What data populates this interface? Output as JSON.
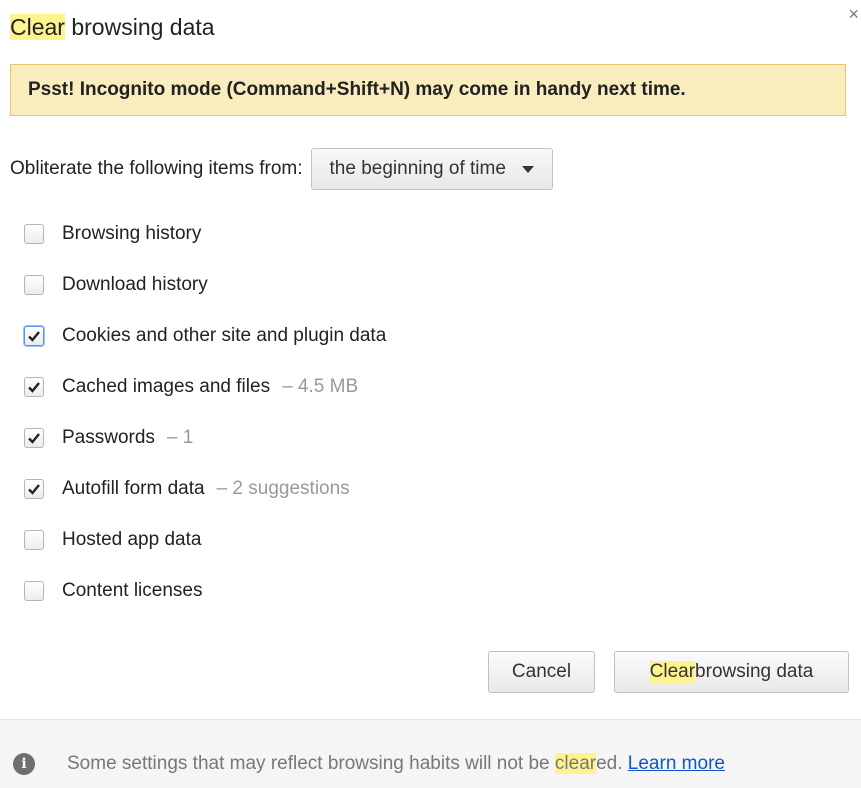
{
  "dialog": {
    "title_highlight": "Clear",
    "title_rest": " browsing data",
    "close_glyph": "×"
  },
  "banner": {
    "text": "Psst! Incognito mode (Command+Shift+N) may come in handy next time."
  },
  "range": {
    "label": "Obliterate the following items from:",
    "selected": "the beginning of time"
  },
  "items": [
    {
      "label": "Browsing history",
      "checked": false,
      "extra": ""
    },
    {
      "label": "Download history",
      "checked": false,
      "extra": ""
    },
    {
      "label": "Cookies and other site and plugin data",
      "checked": true,
      "extra": ""
    },
    {
      "label": "Cached images and files",
      "checked": true,
      "extra": "–  4.5 MB"
    },
    {
      "label": "Passwords",
      "checked": true,
      "extra": "–  1"
    },
    {
      "label": "Autofill form data",
      "checked": true,
      "extra": "–  2 suggestions"
    },
    {
      "label": "Hosted app data",
      "checked": false,
      "extra": ""
    },
    {
      "label": "Content licenses",
      "checked": false,
      "extra": ""
    }
  ],
  "buttons": {
    "cancel": "Cancel",
    "clear_highlight": "Clear",
    "clear_rest": " browsing data"
  },
  "footer": {
    "info_glyph": "i",
    "text_before": "Some settings that may reflect browsing habits will not be ",
    "text_highlight": "clear",
    "text_after": "ed. ",
    "link": "Learn more"
  },
  "colors": {
    "highlight": "#fdf490",
    "banner_bg": "#f9edbe",
    "link": "#1155cc"
  }
}
